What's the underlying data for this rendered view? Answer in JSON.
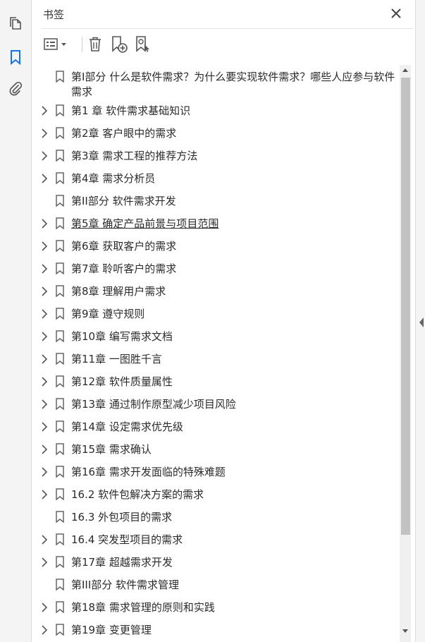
{
  "panel": {
    "title": "书签"
  },
  "left_rail": {
    "icons": [
      "pages-icon",
      "bookmarks-icon",
      "attachments-icon"
    ]
  },
  "toolbar": {
    "icons": [
      "options-menu-icon",
      "delete-icon",
      "new-bookmark-icon",
      "new-bookmark-from-structure-icon"
    ]
  },
  "colors": {
    "accent": "#1473e6",
    "icon_gray": "#555555"
  },
  "bookmarks": [
    {
      "label": "第I部分 什么是软件需求？为什么要实现软件需求？哪些人应参与软件需求",
      "expandable": false
    },
    {
      "label": "第1 章 软件需求基础知识",
      "expandable": true
    },
    {
      "label": "第2章 客户眼中的需求",
      "expandable": true
    },
    {
      "label": "第3章 需求工程的推荐方法",
      "expandable": true
    },
    {
      "label": "第4章 需求分析员",
      "expandable": true
    },
    {
      "label": "第II部分 软件需求开发",
      "expandable": false
    },
    {
      "label": "第5章 确定产品前景与项目范围",
      "expandable": true
    },
    {
      "label": "第6章 获取客户的需求",
      "expandable": true
    },
    {
      "label": "第7章 聆听客户的需求",
      "expandable": true
    },
    {
      "label": "第8章 理解用户需求",
      "expandable": true
    },
    {
      "label": "第9章 遵守规则",
      "expandable": true
    },
    {
      "label": "第10章 编写需求文档",
      "expandable": true
    },
    {
      "label": "第11章 一图胜千言",
      "expandable": true
    },
    {
      "label": "第12章 软件质量属性",
      "expandable": true
    },
    {
      "label": "第13章 通过制作原型减少项目风险",
      "expandable": true
    },
    {
      "label": "第14章 设定需求优先级",
      "expandable": true
    },
    {
      "label": "第15章 需求确认",
      "expandable": true
    },
    {
      "label": "第16章 需求开发面临的特殊难题",
      "expandable": true
    },
    {
      "label": "16.2 软件包解决方案的需求",
      "expandable": true
    },
    {
      "label": "16.3 外包项目的需求",
      "expandable": false
    },
    {
      "label": "16.4 突发型项目的需求",
      "expandable": true
    },
    {
      "label": "第17章 超越需求开发",
      "expandable": true
    },
    {
      "label": "第III部分 软件需求管理",
      "expandable": false
    },
    {
      "label": "第18章 需求管理的原则和实践",
      "expandable": true
    },
    {
      "label": "第19章 变更管理",
      "expandable": true
    }
  ]
}
